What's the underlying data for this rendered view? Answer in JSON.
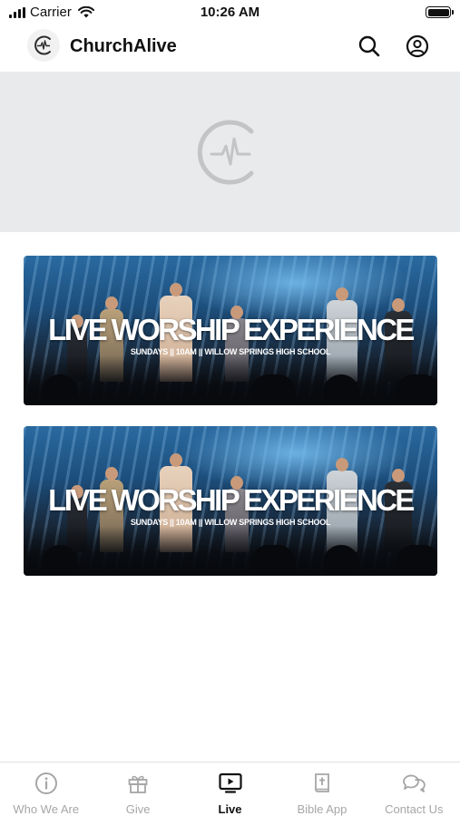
{
  "status_bar": {
    "carrier": "Carrier",
    "time": "10:26 AM",
    "signal_icon": "signal-bars-icon",
    "wifi_icon": "wifi-icon",
    "battery_icon": "battery-icon"
  },
  "header": {
    "title": "ChurchAlive",
    "logo_icon": "churchalive-logo",
    "search_icon": "search-icon",
    "account_icon": "account-circle-icon"
  },
  "hero": {
    "icon": "churchalive-logo-placeholder"
  },
  "banners": [
    {
      "title": "LIVE WORSHIP EXPERIENCE",
      "subtitle": "SUNDAYS || 10AM || WILLOW SPRINGS HIGH SCHOOL"
    },
    {
      "title": "LIVE WORSHIP EXPERIENCE",
      "subtitle": "SUNDAYS || 10AM || WILLOW SPRINGS HIGH SCHOOL"
    }
  ],
  "tabs": [
    {
      "label": "Who We Are",
      "icon": "info-circle-icon",
      "active": false
    },
    {
      "label": "Give",
      "icon": "gift-icon",
      "active": false
    },
    {
      "label": "Live",
      "icon": "play-tv-icon",
      "active": true
    },
    {
      "label": "Bible App",
      "icon": "bible-icon",
      "active": false
    },
    {
      "label": "Contact Us",
      "icon": "chat-bubbles-icon",
      "active": false
    }
  ],
  "colors": {
    "active_tab": "#111111",
    "inactive_tab": "#a6a6a6",
    "hero_background": "#e9eaec",
    "banner_blue": "#2a6aa0"
  }
}
